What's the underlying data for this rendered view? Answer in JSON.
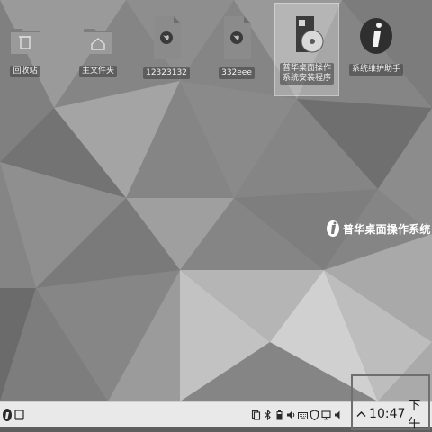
{
  "desktop": {
    "icons": [
      {
        "label": "回收站",
        "icon": "trash-icon"
      },
      {
        "label": "主文件夹",
        "icon": "home-folder-icon"
      },
      {
        "label": "12323132",
        "icon": "web-file-icon"
      },
      {
        "label": "332eee",
        "icon": "web-file-icon"
      },
      {
        "label": "普华桌面操作\n系统安装程序",
        "icon": "installer-disc-icon"
      },
      {
        "label": "系统维护助手",
        "icon": "info-icon"
      }
    ],
    "brand": {
      "text": "普华桌面操作系统",
      "icon": "brand-logo-icon"
    }
  },
  "taskbar": {
    "start_icon": "start-menu-icon",
    "show_desktop_icon": "show-desktop-icon",
    "tray_icons": [
      "clipboard-icon",
      "bluetooth-icon",
      "battery-icon",
      "volume-icon",
      "keyboard-icon",
      "shield-icon",
      "display-icon",
      "speaker-icon"
    ],
    "clock": {
      "time": "10:47",
      "period": "下午"
    }
  },
  "colors": {
    "taskbar_bg": "#e9e9e9",
    "wallpaper_base": "#8a8a8a",
    "label_text": "#f2f2f2"
  }
}
